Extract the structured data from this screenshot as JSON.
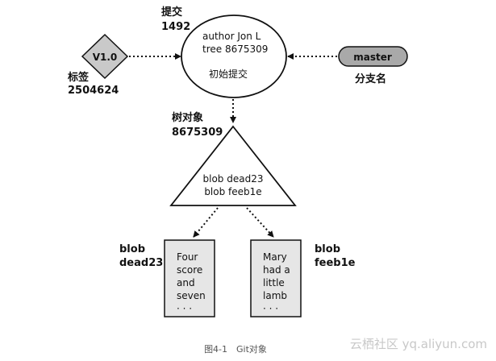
{
  "commit": {
    "label": "提交",
    "id": "1492",
    "lines": [
      "author Jon L",
      "tree 8675309"
    ],
    "desc": "初始提交"
  },
  "tag": {
    "name": "V1.0",
    "label": "标签",
    "id": "2504624"
  },
  "branch": {
    "name": "master",
    "label": "分支名"
  },
  "tree": {
    "label": "树对象",
    "id": "8675309",
    "entries": [
      "blob dead23",
      "blob feeb1e"
    ]
  },
  "blobs": [
    {
      "title": "blob",
      "id": "dead23",
      "lines": [
        "Four",
        "score",
        "and",
        "seven",
        "· · ·"
      ]
    },
    {
      "title": "blob",
      "id": "feeb1e",
      "lines": [
        "Mary",
        "had a",
        "little",
        "lamb",
        "· · ·"
      ]
    }
  ],
  "caption": "图4-1　Git对象",
  "watermark": "云栖社区 yq.aliyun.com",
  "colors": {
    "line": "#111111",
    "branch_fill": "#a9a9a9",
    "tag_fill": "#c9c9c9",
    "blob_fill": "#e6e6e6"
  }
}
